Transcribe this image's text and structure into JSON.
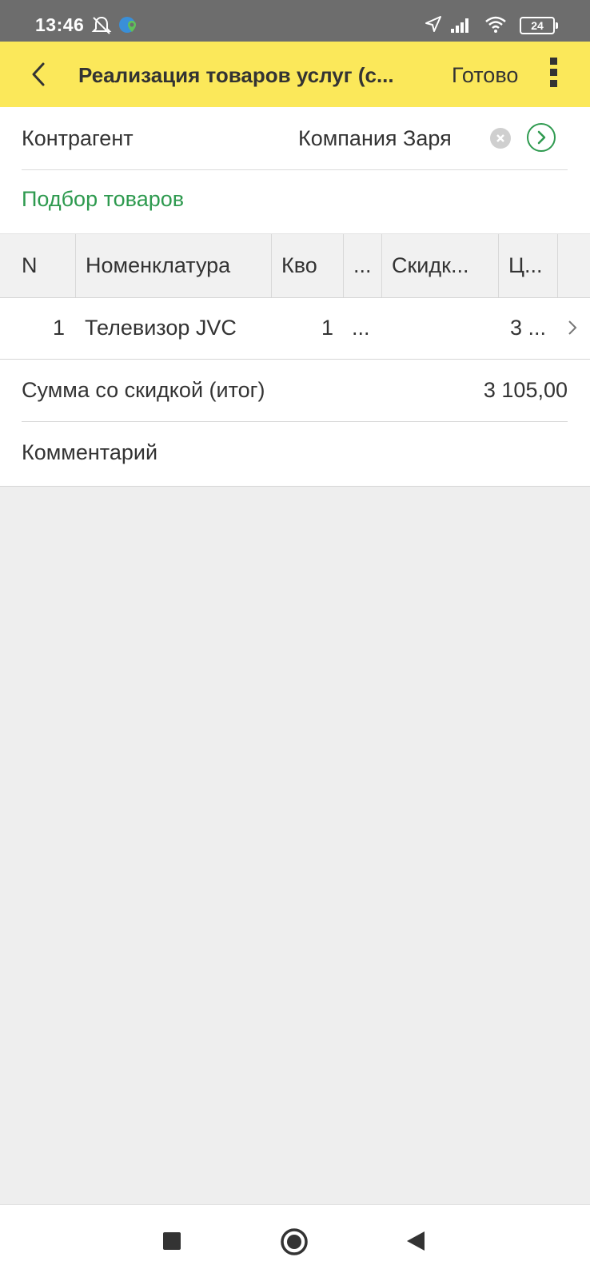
{
  "status_bar": {
    "time": "13:46",
    "battery_level": "24",
    "icons": [
      "muted-alarm-icon",
      "location-app-icon",
      "navigation-icon",
      "signal-icon",
      "wifi-icon",
      "battery-icon"
    ]
  },
  "toolbar": {
    "title": "Реализация товаров услуг (с...",
    "done_label": "Готово",
    "background_color": "#fbe85a"
  },
  "form": {
    "counterparty_label": "Контрагент",
    "counterparty_value": "Компания Заря",
    "selector_link": "Подбор товаров",
    "accent_color": "#2e9a4f"
  },
  "table": {
    "columns": [
      "N",
      "Номенклатура",
      "Кво",
      "...",
      "Скидк...",
      "Ц..."
    ],
    "rows": [
      {
        "n": "1",
        "item": "Телевизор JVC",
        "qty": "1",
        "unit": "...",
        "discount": "",
        "price": "3 ..."
      }
    ]
  },
  "totals": {
    "sum_label": "Сумма со скидкой (итог)",
    "sum_value": "3 105,00"
  },
  "comment": {
    "label": "Комментарий"
  },
  "nav_bar": {
    "buttons": [
      "recent-apps-icon",
      "home-icon",
      "back-nav-icon"
    ]
  }
}
